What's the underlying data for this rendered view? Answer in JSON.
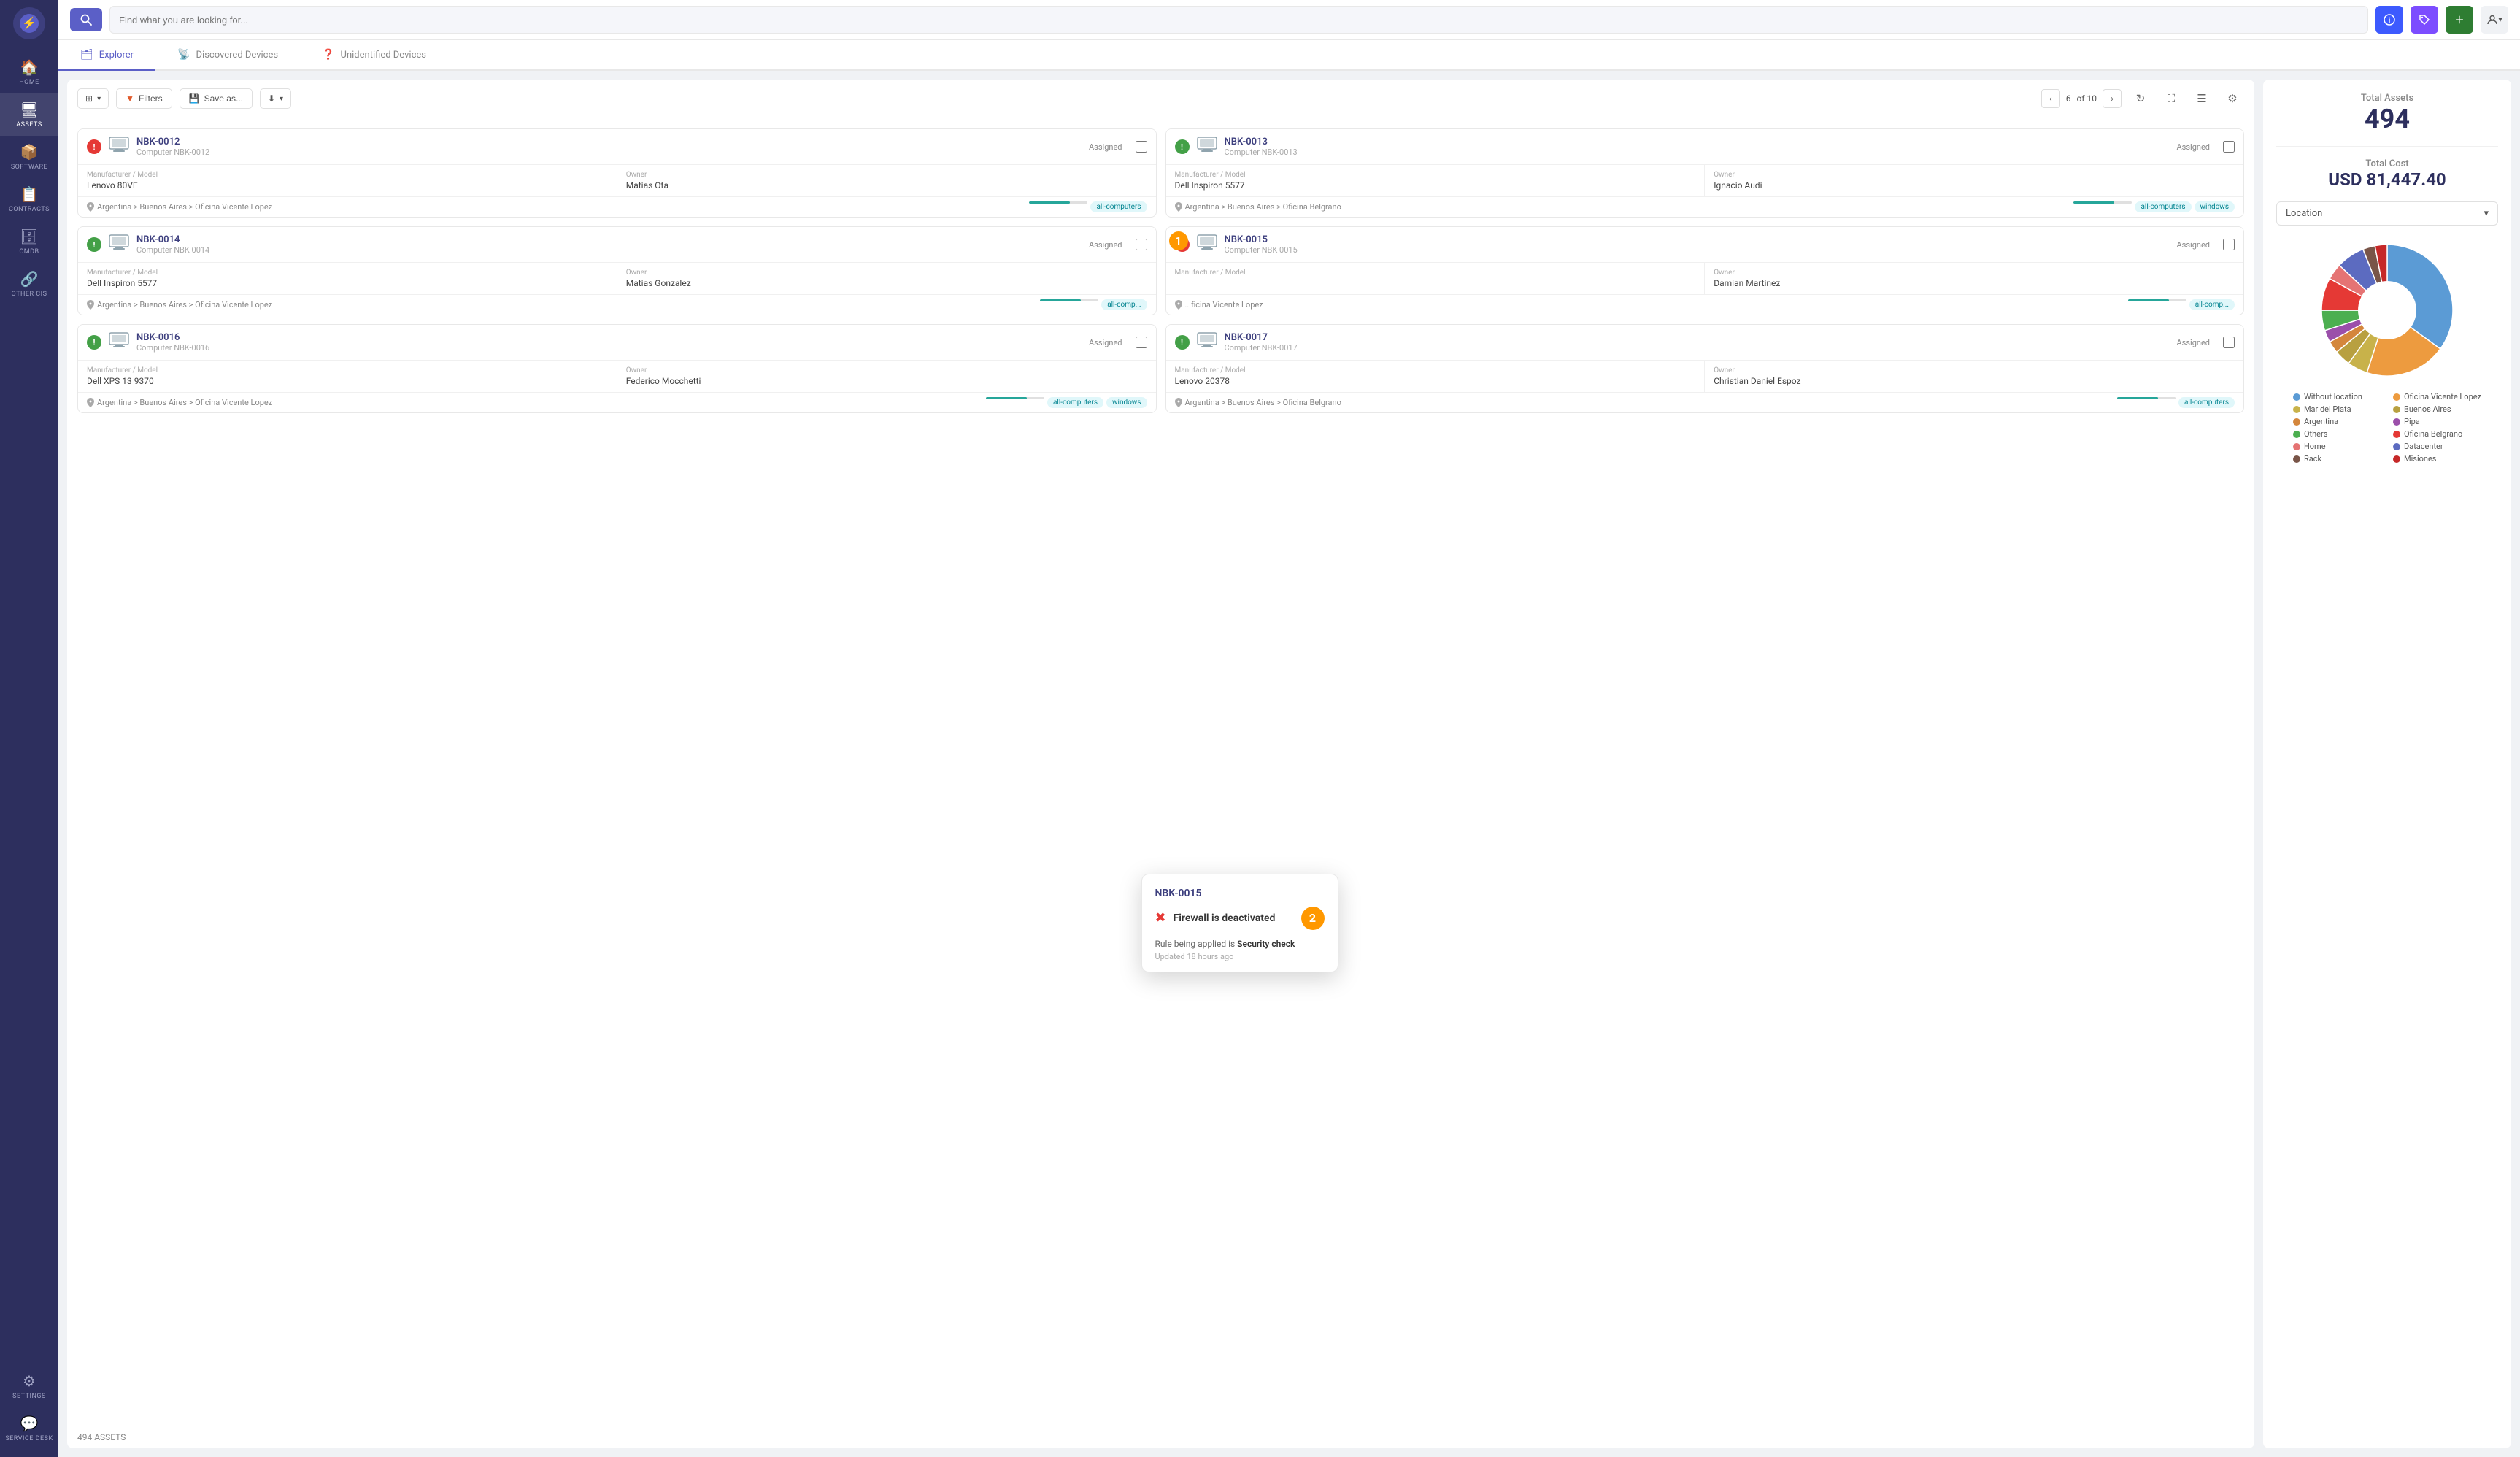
{
  "sidebar": {
    "logo": "⚡",
    "items": [
      {
        "id": "home",
        "label": "HOME",
        "icon": "🏠",
        "active": false
      },
      {
        "id": "assets",
        "label": "ASSETS",
        "icon": "🖥",
        "active": true
      },
      {
        "id": "software",
        "label": "SOFTWARE",
        "icon": "🟧",
        "active": false
      },
      {
        "id": "contracts",
        "label": "CONTRACTS",
        "icon": "📋",
        "active": false
      },
      {
        "id": "cmdb",
        "label": "CMDB",
        "icon": "🗄",
        "active": false
      },
      {
        "id": "other-cis",
        "label": "OTHER CIs",
        "icon": "🔗",
        "active": false
      },
      {
        "id": "settings",
        "label": "SETTINGS",
        "icon": "⚙",
        "active": false
      },
      {
        "id": "service-desk",
        "label": "SERVICE DESK",
        "icon": "💬",
        "active": false
      }
    ]
  },
  "topbar": {
    "search_placeholder": "Find what you are looking for...",
    "action_info": "ℹ",
    "action_tag": "🏷",
    "action_add": "+",
    "action_user": "👤"
  },
  "nav_tabs": [
    {
      "id": "explorer",
      "label": "Explorer",
      "icon": "🗂",
      "active": true
    },
    {
      "id": "discovered",
      "label": "Discovered Devices",
      "icon": "📡",
      "active": false
    },
    {
      "id": "unidentified",
      "label": "Unidentified Devices",
      "icon": "❓",
      "active": false
    }
  ],
  "toolbar": {
    "filters_label": "Filters",
    "save_label": "Save as...",
    "download_label": "↓",
    "pagination_current": "6",
    "pagination_total": "of 10",
    "refresh_icon": "↻",
    "fullscreen_icon": "⛶",
    "list_icon": "☰",
    "settings_icon": "⚙"
  },
  "assets": [
    {
      "id": "NBK-0012",
      "title": "NBK-0012",
      "subtitle": "Computer NBK-0012",
      "status": "Assigned",
      "badge_type": "alert",
      "manufacturer_label": "Manufacturer / Model",
      "manufacturer_value": "Lenovo 80VE",
      "owner_label": "Owner",
      "owner_value": "Matias Ota",
      "location": "Argentina > Buenos Aires > Oficina Vicente Lopez",
      "tags": [
        "all-computers"
      ],
      "tag_types": [
        "teal"
      ]
    },
    {
      "id": "NBK-0013",
      "title": "NBK-0013",
      "subtitle": "Computer NBK-0013",
      "status": "Assigned",
      "badge_type": "ok",
      "manufacturer_label": "Manufacturer / Model",
      "manufacturer_value": "Dell Inspiron 5577",
      "owner_label": "Owner",
      "owner_value": "Ignacio Audi",
      "location": "Argentina > Buenos Aires > Oficina Belgrano",
      "tags": [
        "all-computers",
        "windows"
      ],
      "tag_types": [
        "teal",
        "teal"
      ]
    },
    {
      "id": "NBK-0014",
      "title": "NBK-0014",
      "subtitle": "Computer NBK-0014",
      "status": "Assigned",
      "badge_type": "ok",
      "manufacturer_label": "Manufacturer / Model",
      "manufacturer_value": "Dell Inspiron 5577",
      "owner_label": "Owner",
      "owner_value": "Matias Gonzalez",
      "location": "Argentina > Buenos Aires > Oficina Vicente Lopez",
      "tags": [
        "all-comp..."
      ],
      "tag_types": [
        "teal"
      ]
    },
    {
      "id": "NBK-0015",
      "title": "NBK-0015",
      "subtitle": "Computer NBK-0015",
      "status": "Assigned",
      "badge_type": "alert",
      "manufacturer_label": "Manufacturer / Model",
      "manufacturer_value": "",
      "owner_label": "Owner",
      "owner_value": "Damian Martinez",
      "location": "...ficina Vicente Lopez",
      "tags": [
        "all-comp..."
      ],
      "tag_types": [
        "teal"
      ],
      "has_tooltip": true,
      "notification_number": 1
    },
    {
      "id": "NBK-0016",
      "title": "NBK-0016",
      "subtitle": "Computer NBK-0016",
      "status": "Assigned",
      "badge_type": "ok",
      "manufacturer_label": "Manufacturer / Model",
      "manufacturer_value": "Dell XPS 13 9370",
      "owner_label": "Owner",
      "owner_value": "Federico Mocchetti",
      "location": "Argentina > Buenos Aires > Oficina Vicente Lopez",
      "tags": [
        "all-computers",
        "windows"
      ],
      "tag_types": [
        "teal",
        "teal"
      ]
    },
    {
      "id": "NBK-0017",
      "title": "NBK-0017",
      "subtitle": "Computer NBK-0017",
      "status": "Assigned",
      "badge_type": "ok",
      "manufacturer_label": "Manufacturer / Model",
      "manufacturer_value": "Lenovo 20378",
      "owner_label": "Owner",
      "owner_value": "Christian Daniel Espoz",
      "location": "Argentina > Buenos Aires > Oficina Belgrano",
      "tags": [
        "all-computers"
      ],
      "tag_types": [
        "teal"
      ]
    }
  ],
  "tooltip": {
    "title": "NBK-0015",
    "alert_text": "Firewall is deactivated",
    "rule_prefix": "Rule being applied is",
    "rule_name": "Security check",
    "updated": "Updated 18 hours ago",
    "badge_number": 2
  },
  "right_panel": {
    "total_assets_label": "Total Assets",
    "total_assets_value": "494",
    "total_cost_label": "Total Cost",
    "total_cost_value": "USD 81,447.40",
    "location_dropdown": "Location",
    "pie_chart": {
      "segments": [
        {
          "label": "Without location",
          "color": "#5b9bd5",
          "value": 35
        },
        {
          "label": "Oficina Vicente Lopez",
          "color": "#ed9b3f",
          "value": 20
        },
        {
          "label": "Mar del Plata",
          "color": "#c8b24a",
          "value": 5
        },
        {
          "label": "Buenos Aires",
          "color": "#b8a040",
          "value": 4
        },
        {
          "label": "Argentina",
          "color": "#d4863c",
          "value": 3
        },
        {
          "label": "Pipa",
          "color": "#9b4faa",
          "value": 3
        },
        {
          "label": "Others",
          "color": "#4caf50",
          "value": 5
        },
        {
          "label": "Oficina Belgrano",
          "color": "#e53935",
          "value": 8
        },
        {
          "label": "Home",
          "color": "#e57373",
          "value": 4
        },
        {
          "label": "Datacenter",
          "color": "#5c6bc0",
          "value": 7
        },
        {
          "label": "Rack",
          "color": "#795548",
          "value": 3
        },
        {
          "label": "Misiones",
          "color": "#c62828",
          "value": 3
        }
      ]
    }
  },
  "asset_footer": {
    "count": "494",
    "label": "ASSETS"
  }
}
